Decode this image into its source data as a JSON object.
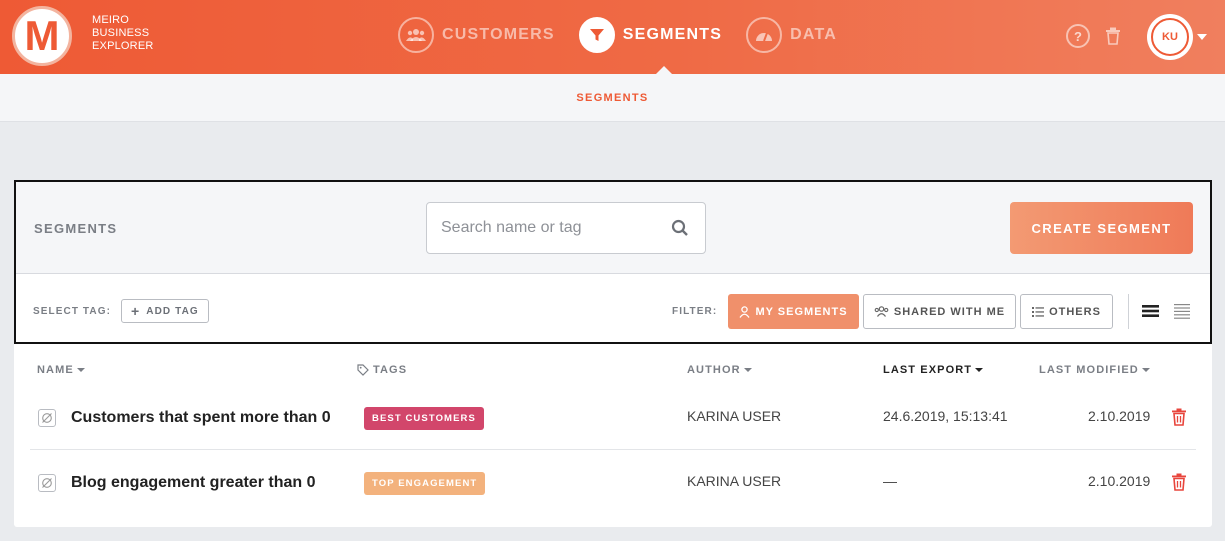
{
  "header": {
    "logo_letter": "M",
    "brand": [
      "MEIRO",
      "BUSINESS",
      "EXPLORER"
    ],
    "nav": [
      {
        "label": "CUSTOMERS",
        "icon": "users-icon",
        "active": false
      },
      {
        "label": "SEGMENTS",
        "icon": "filter-icon",
        "active": true
      },
      {
        "label": "DATA",
        "icon": "gauge-icon",
        "active": false
      }
    ],
    "help_label": "?",
    "avatar_initials": "KU"
  },
  "subnav": {
    "label": "SEGMENTS"
  },
  "panel": {
    "title": "SEGMENTS",
    "search_placeholder": "Search name or tag",
    "create_label": "CREATE SEGMENT",
    "select_tag_label": "SELECT TAG:",
    "add_tag_label": "ADD TAG",
    "filter_label": "FILTER:",
    "filters": {
      "my": "MY SEGMENTS",
      "shared": "SHARED WITH ME",
      "others": "OTHERS"
    }
  },
  "table": {
    "columns": {
      "name": "NAME",
      "tags": "TAGS",
      "author": "AUTHOR",
      "last_export": "LAST EXPORT",
      "last_modified": "LAST MODIFIED"
    },
    "rows": [
      {
        "name": "Customers that spent more than 0",
        "tag": "BEST CUSTOMERS",
        "tag_color": "#d2466b",
        "author": "KARINA USER",
        "last_export": "24.6.2019, 15:13:41",
        "last_modified": "2.10.2019"
      },
      {
        "name": "Blog engagement greater than 0",
        "tag": "TOP ENGAGEMENT",
        "tag_color": "#f3b27d",
        "author": "KARINA USER",
        "last_export": "—",
        "last_modified": "2.10.2019"
      }
    ]
  },
  "colors": {
    "accent": "#ee5a35",
    "delete": "#e8453c"
  }
}
